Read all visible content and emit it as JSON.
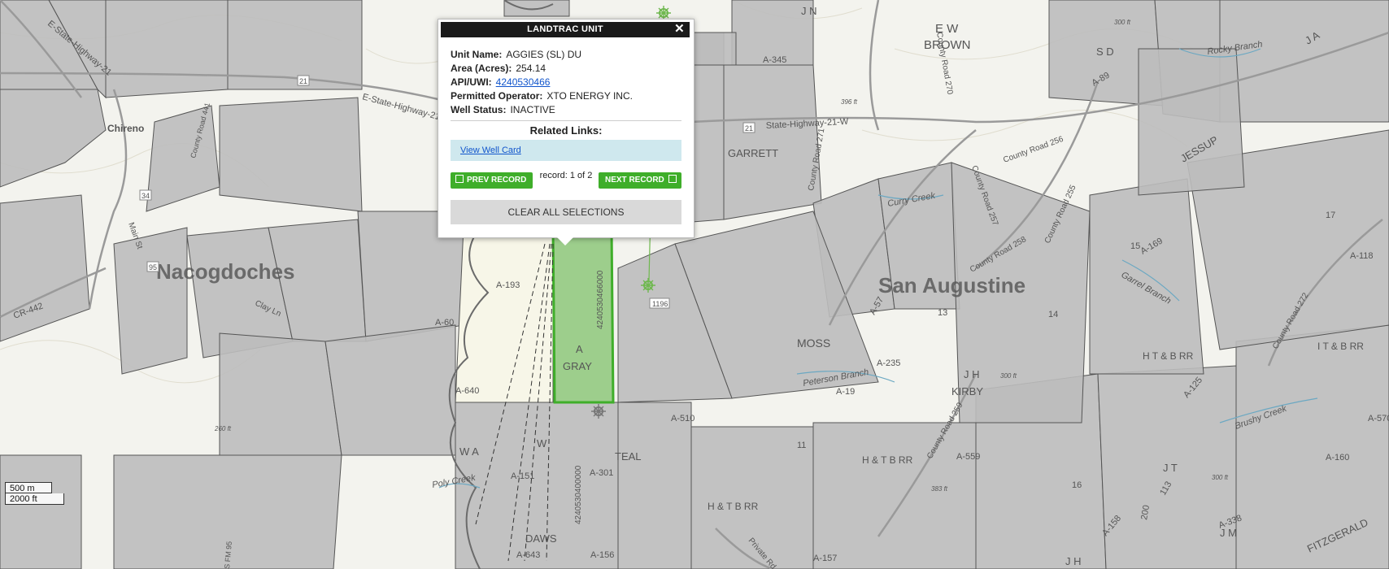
{
  "popup": {
    "title": "LANDTRAC UNIT",
    "close_glyph": "✕",
    "fields": {
      "unit_name": {
        "label": "Unit Name:",
        "value": "AGGIES (SL) DU"
      },
      "area": {
        "label": "Area (Acres):",
        "value": "254.14"
      },
      "api": {
        "label": "API/UWI:",
        "value": "4240530466"
      },
      "operator": {
        "label": "Permitted Operator:",
        "value": "XTO ENERGY INC."
      },
      "status": {
        "label": "Well Status:",
        "value": "INACTIVE"
      }
    },
    "related_links_title": "Related Links:",
    "view_well_card": "View Well Card",
    "prev_record": "PREV RECORD",
    "next_record": "NEXT RECORD",
    "record_count": "record: 1 of 2",
    "clear_all": "CLEAR ALL SELECTIONS"
  },
  "scale": {
    "metric": "500 m",
    "imperial": "2000 ft"
  },
  "map_labels": {
    "county_nacogdoches": "Nacogdoches",
    "county_san_augustine": "San Augustine",
    "chireno": "Chireno",
    "highway_21": "21",
    "state_highway_21_w": "State-Highway-21-W",
    "e_state_highway_21_a": "E-State-Highway-21",
    "e_state_highway_21_b": "E-State-Highway-21",
    "county_road_270": "County Road 270",
    "county_road_271": "County Road 271",
    "county_road_256": "County Road 256",
    "county_road_257": "County Road 257",
    "county_road_258": "County Road 258",
    "county_road_255": "County Road 255",
    "county_road_441": "County Road 441",
    "county_road_272": "County Road 272",
    "county_road_259": "County Road 259",
    "cr_442": "CR-442",
    "main_st": "Main St",
    "clay_ln": "Clay Ln",
    "hwy_34": "34",
    "hwy_95": "95",
    "fm_1196": "1196",
    "fm_95": "S FM 95",
    "private_rd": "Private Rd",
    "garrett": "GARRETT",
    "e_w_brown_1": "E W",
    "e_w_brown_2": "BROWN",
    "moss": "MOSS",
    "teal": "TEAL",
    "a_gray_1": "A",
    "a_gray_2": "GRAY",
    "jessup": "JESSUP",
    "jn": "J N",
    "sd": "S D",
    "ja": "J A",
    "a_345": "A-345",
    "a_193": "A-193",
    "a_60": "A-60",
    "a_640": "A-640",
    "a_510": "A-510",
    "a_151": "A-151",
    "a_301": "A-301",
    "a_156": "A-156",
    "a_643": "A-643",
    "a_157": "A-157",
    "a_559": "A-559",
    "a_235": "A-235",
    "a_19": "A-19",
    "a_158": "A-158",
    "a_125": "A-125",
    "a_169": "A-169",
    "a_118": "A-118",
    "a_160": "A-160",
    "a_570": "A-570",
    "a_338": "A-338",
    "a_89": "A-89",
    "a_57": "A-57",
    "ht_b_rr_1": "H T & B RR",
    "ht_b_rr_2": "H & T B RR",
    "ht_b_rr_3": "H & T B RR",
    "it_b_rr": "I T & B RR",
    "jh_kirby_1": "J H",
    "jh_kirby_2": "KIRBY",
    "jh": "J H",
    "jt": "J T",
    "jm": "J M",
    "fitzgerald": "FITZGERALD",
    "daws": "DAWS",
    "w_a": "W A",
    "w": "W",
    "n11": "11",
    "n13": "13",
    "n14": "14",
    "n15": "15",
    "n16": "16",
    "n17": "17",
    "n200": "200",
    "n113": "113",
    "curry_creek": "Curry Creek",
    "peterson_branch": "Peterson Branch",
    "garrel_branch": "Garrel Branch",
    "rocky_branch": "Rocky Branch",
    "brushy_creek": "Brushy Creek",
    "poly_creek": "Poly Creek",
    "contour_396": "396 ft",
    "contour_383": "383 ft",
    "contour_300a": "300 ft",
    "contour_300b": "300 ft",
    "contour_300c": "300 ft",
    "contour_260": "260 ft",
    "well_api_1": "4240530466000",
    "well_api_2": "4240530400000"
  },
  "colors": {
    "parcel_fill": "#bdbdbd",
    "selected_fill": "#8dc77a",
    "selected_stroke": "#3fae2a",
    "road": "#9a9a9a",
    "creek": "#6ba8c2",
    "well_icon": "#6fb84f"
  }
}
